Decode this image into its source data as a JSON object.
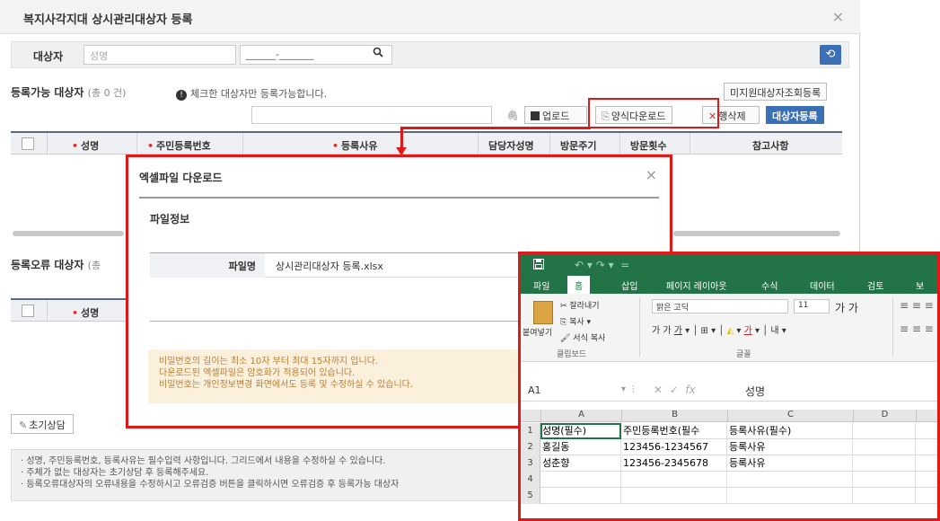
{
  "window": {
    "title": "복지사각지대 상시관리대상자 등록",
    "close": "×"
  },
  "search": {
    "label": "대상자",
    "name_placeholder": "성명",
    "ssn_value": "______-_______",
    "search_icon": "search-icon",
    "refresh_icon": "refresh-icon"
  },
  "registerable": {
    "title": "등록가능 대상자",
    "count": "(총 0 건)",
    "notice": "체크한 대상자만 등록가능합니다.",
    "notice_icon": "info-icon",
    "unsupported_btn": "미지원대상자조회등록",
    "upload_btn": "업로드",
    "template_btn": "양식다운로드",
    "delete_btn": "행삭제",
    "register_btn": "대상자등록",
    "columns": [
      "성명",
      "주민등록번호",
      "등록사유",
      "담당자성명",
      "방문주기",
      "방문횟수",
      "참고사항"
    ]
  },
  "errors": {
    "title": "등록오류 대상자",
    "count": "(총",
    "columns": [
      "성명"
    ]
  },
  "init_btn": "초기상담",
  "footer_notes": [
    "· 성명, 주민등록번호, 등록사유는 필수입력 사항입니다. 그리드에서 내용을 수정하실 수 있습니다.",
    "· 주체가 없는 대상자는 초기상담 후 등록해주세요.",
    "· 등록오류대상자의 오류내용을 수정하시고 오류검증 버튼을 클릭하시면 오류검증 후 등록가능 대상자"
  ],
  "modal": {
    "title": "엑셀파일 다운로드",
    "close": "×",
    "section": "파일정보",
    "file_label": "파일명",
    "file_value": "상시관리대상자 등록.xlsx",
    "warnings": [
      "비밀번호의 길이는 최소 10자 부터 최대 15자까지 입니다.",
      "다운로드된 엑셀파일은 암호화가 적용되어 있습니다.",
      "비밀번호는 개인정보변경 화면에서도 등록 및 수정하실 수 있습니다."
    ]
  },
  "excel": {
    "tabs": [
      "파일",
      "홈",
      "삽입",
      "페이지 레이아웃",
      "수식",
      "데이터",
      "검토",
      "보"
    ],
    "active_tab": "홈",
    "clipboard": {
      "cut": "잘라내기",
      "copy": "복사",
      "paste": "붙여넣기",
      "format_painter": "서식 복사",
      "group": "클립보드"
    },
    "font": {
      "name": "맑은 고딕",
      "size": "11",
      "group": "글꼴"
    },
    "name_box": "A1",
    "formula_value": "성명",
    "columns": [
      "A",
      "B",
      "C",
      "D"
    ],
    "rows": [
      {
        "n": "1",
        "cells": [
          "성명(필수)",
          "주민등록번호(필수",
          "등록사유(필수)",
          ""
        ]
      },
      {
        "n": "2",
        "cells": [
          "홍길동",
          "123456-1234567",
          "등록사유",
          ""
        ]
      },
      {
        "n": "3",
        "cells": [
          "성춘향",
          "123456-2345678",
          "등록사유",
          ""
        ]
      },
      {
        "n": "4",
        "cells": [
          "",
          "",
          "",
          ""
        ]
      },
      {
        "n": "5",
        "cells": [
          "",
          "",
          "",
          ""
        ]
      }
    ]
  },
  "colors": {
    "accent": "#3b6fb6",
    "highlight": "#e01818",
    "excel_green": "#227447"
  }
}
